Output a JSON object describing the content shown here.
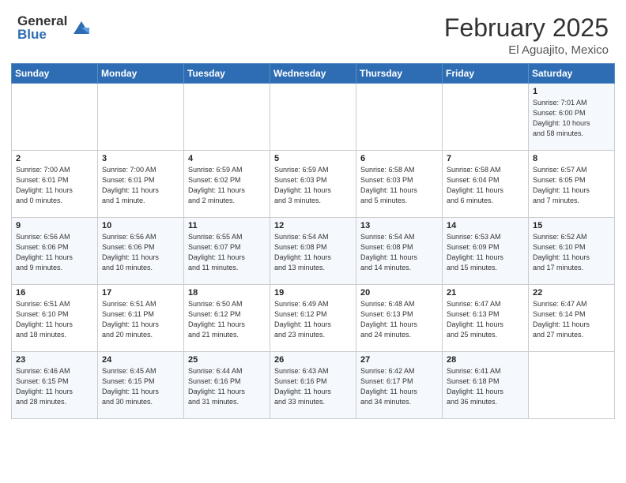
{
  "logo": {
    "general": "General",
    "blue": "Blue"
  },
  "header": {
    "month": "February 2025",
    "location": "El Aguajito, Mexico"
  },
  "weekdays": [
    "Sunday",
    "Monday",
    "Tuesday",
    "Wednesday",
    "Thursday",
    "Friday",
    "Saturday"
  ],
  "weeks": [
    [
      {
        "day": "",
        "info": ""
      },
      {
        "day": "",
        "info": ""
      },
      {
        "day": "",
        "info": ""
      },
      {
        "day": "",
        "info": ""
      },
      {
        "day": "",
        "info": ""
      },
      {
        "day": "",
        "info": ""
      },
      {
        "day": "1",
        "info": "Sunrise: 7:01 AM\nSunset: 6:00 PM\nDaylight: 10 hours\nand 58 minutes."
      }
    ],
    [
      {
        "day": "2",
        "info": "Sunrise: 7:00 AM\nSunset: 6:01 PM\nDaylight: 11 hours\nand 0 minutes."
      },
      {
        "day": "3",
        "info": "Sunrise: 7:00 AM\nSunset: 6:01 PM\nDaylight: 11 hours\nand 1 minute."
      },
      {
        "day": "4",
        "info": "Sunrise: 6:59 AM\nSunset: 6:02 PM\nDaylight: 11 hours\nand 2 minutes."
      },
      {
        "day": "5",
        "info": "Sunrise: 6:59 AM\nSunset: 6:03 PM\nDaylight: 11 hours\nand 3 minutes."
      },
      {
        "day": "6",
        "info": "Sunrise: 6:58 AM\nSunset: 6:03 PM\nDaylight: 11 hours\nand 5 minutes."
      },
      {
        "day": "7",
        "info": "Sunrise: 6:58 AM\nSunset: 6:04 PM\nDaylight: 11 hours\nand 6 minutes."
      },
      {
        "day": "8",
        "info": "Sunrise: 6:57 AM\nSunset: 6:05 PM\nDaylight: 11 hours\nand 7 minutes."
      }
    ],
    [
      {
        "day": "9",
        "info": "Sunrise: 6:56 AM\nSunset: 6:06 PM\nDaylight: 11 hours\nand 9 minutes."
      },
      {
        "day": "10",
        "info": "Sunrise: 6:56 AM\nSunset: 6:06 PM\nDaylight: 11 hours\nand 10 minutes."
      },
      {
        "day": "11",
        "info": "Sunrise: 6:55 AM\nSunset: 6:07 PM\nDaylight: 11 hours\nand 11 minutes."
      },
      {
        "day": "12",
        "info": "Sunrise: 6:54 AM\nSunset: 6:08 PM\nDaylight: 11 hours\nand 13 minutes."
      },
      {
        "day": "13",
        "info": "Sunrise: 6:54 AM\nSunset: 6:08 PM\nDaylight: 11 hours\nand 14 minutes."
      },
      {
        "day": "14",
        "info": "Sunrise: 6:53 AM\nSunset: 6:09 PM\nDaylight: 11 hours\nand 15 minutes."
      },
      {
        "day": "15",
        "info": "Sunrise: 6:52 AM\nSunset: 6:10 PM\nDaylight: 11 hours\nand 17 minutes."
      }
    ],
    [
      {
        "day": "16",
        "info": "Sunrise: 6:51 AM\nSunset: 6:10 PM\nDaylight: 11 hours\nand 18 minutes."
      },
      {
        "day": "17",
        "info": "Sunrise: 6:51 AM\nSunset: 6:11 PM\nDaylight: 11 hours\nand 20 minutes."
      },
      {
        "day": "18",
        "info": "Sunrise: 6:50 AM\nSunset: 6:12 PM\nDaylight: 11 hours\nand 21 minutes."
      },
      {
        "day": "19",
        "info": "Sunrise: 6:49 AM\nSunset: 6:12 PM\nDaylight: 11 hours\nand 23 minutes."
      },
      {
        "day": "20",
        "info": "Sunrise: 6:48 AM\nSunset: 6:13 PM\nDaylight: 11 hours\nand 24 minutes."
      },
      {
        "day": "21",
        "info": "Sunrise: 6:47 AM\nSunset: 6:13 PM\nDaylight: 11 hours\nand 25 minutes."
      },
      {
        "day": "22",
        "info": "Sunrise: 6:47 AM\nSunset: 6:14 PM\nDaylight: 11 hours\nand 27 minutes."
      }
    ],
    [
      {
        "day": "23",
        "info": "Sunrise: 6:46 AM\nSunset: 6:15 PM\nDaylight: 11 hours\nand 28 minutes."
      },
      {
        "day": "24",
        "info": "Sunrise: 6:45 AM\nSunset: 6:15 PM\nDaylight: 11 hours\nand 30 minutes."
      },
      {
        "day": "25",
        "info": "Sunrise: 6:44 AM\nSunset: 6:16 PM\nDaylight: 11 hours\nand 31 minutes."
      },
      {
        "day": "26",
        "info": "Sunrise: 6:43 AM\nSunset: 6:16 PM\nDaylight: 11 hours\nand 33 minutes."
      },
      {
        "day": "27",
        "info": "Sunrise: 6:42 AM\nSunset: 6:17 PM\nDaylight: 11 hours\nand 34 minutes."
      },
      {
        "day": "28",
        "info": "Sunrise: 6:41 AM\nSunset: 6:18 PM\nDaylight: 11 hours\nand 36 minutes."
      },
      {
        "day": "",
        "info": ""
      }
    ]
  ]
}
